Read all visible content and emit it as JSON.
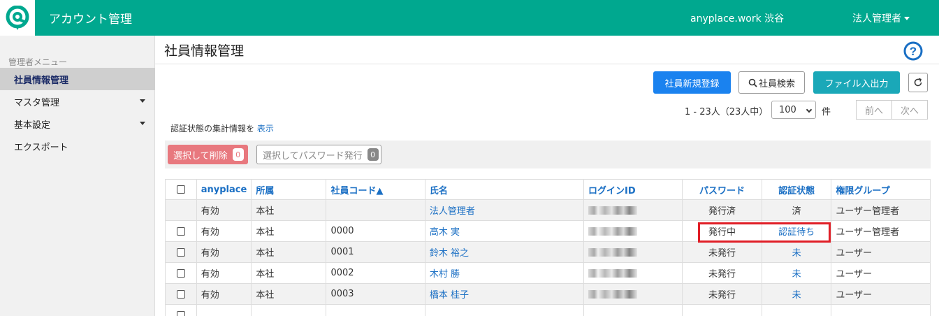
{
  "header": {
    "app_title": "アカウント管理",
    "workspace": "anyplace.work 渋谷",
    "admin_label": "法人管理者"
  },
  "sidebar": {
    "heading": "管理者メニュー",
    "items": [
      {
        "label": "社員情報管理"
      },
      {
        "label": "マスタ管理"
      },
      {
        "label": "基本設定"
      },
      {
        "label": "エクスポート"
      }
    ]
  },
  "main": {
    "title": "社員情報管理",
    "buttons": {
      "new": "社員新規登録",
      "search": "社員検索",
      "file_io": "ファイル入出力"
    },
    "range": "1 - 23人（23人中）",
    "per_page": "100",
    "unit": "件",
    "prev": "前へ",
    "next": "次へ",
    "summary_text": "認証状態の集計情報を",
    "summary_link": "表示",
    "bulk_delete": "選択して削除",
    "bulk_delete_count": "0",
    "bulk_password": "選択してパスワード発行",
    "bulk_password_count": "0"
  },
  "table": {
    "columns": [
      "anyplace",
      "所属",
      "社員コード▲",
      "氏名",
      "ログインID",
      "パスワード",
      "認証状態",
      "権限グループ"
    ],
    "rows": [
      {
        "status": "有効",
        "dept": "本社",
        "code": "",
        "name": "法人管理者",
        "password": "発行済",
        "auth": "済",
        "group": "ユーザー管理者"
      },
      {
        "status": "有効",
        "dept": "本社",
        "code": "0000",
        "name": "高木 実",
        "password": "発行中",
        "auth": "認証待ち",
        "group": "ユーザー管理者"
      },
      {
        "status": "有効",
        "dept": "本社",
        "code": "0001",
        "name": "鈴木 裕之",
        "password": "未発行",
        "auth": "未",
        "group": "ユーザー"
      },
      {
        "status": "有効",
        "dept": "本社",
        "code": "0002",
        "name": "木村 勝",
        "password": "未発行",
        "auth": "未",
        "group": "ユーザー"
      },
      {
        "status": "有効",
        "dept": "本社",
        "code": "0003",
        "name": "橋本 桂子",
        "password": "未発行",
        "auth": "未",
        "group": "ユーザー"
      }
    ]
  },
  "colors": {
    "brand": "#00a88f",
    "primary": "#1a82ef",
    "teal": "#1aa8b8",
    "danger": "#e8787e",
    "highlight": "#e01e26"
  },
  "icons": [
    "app-logo-icon",
    "caret-down-icon",
    "help-circle-icon",
    "search-icon",
    "refresh-icon"
  ]
}
